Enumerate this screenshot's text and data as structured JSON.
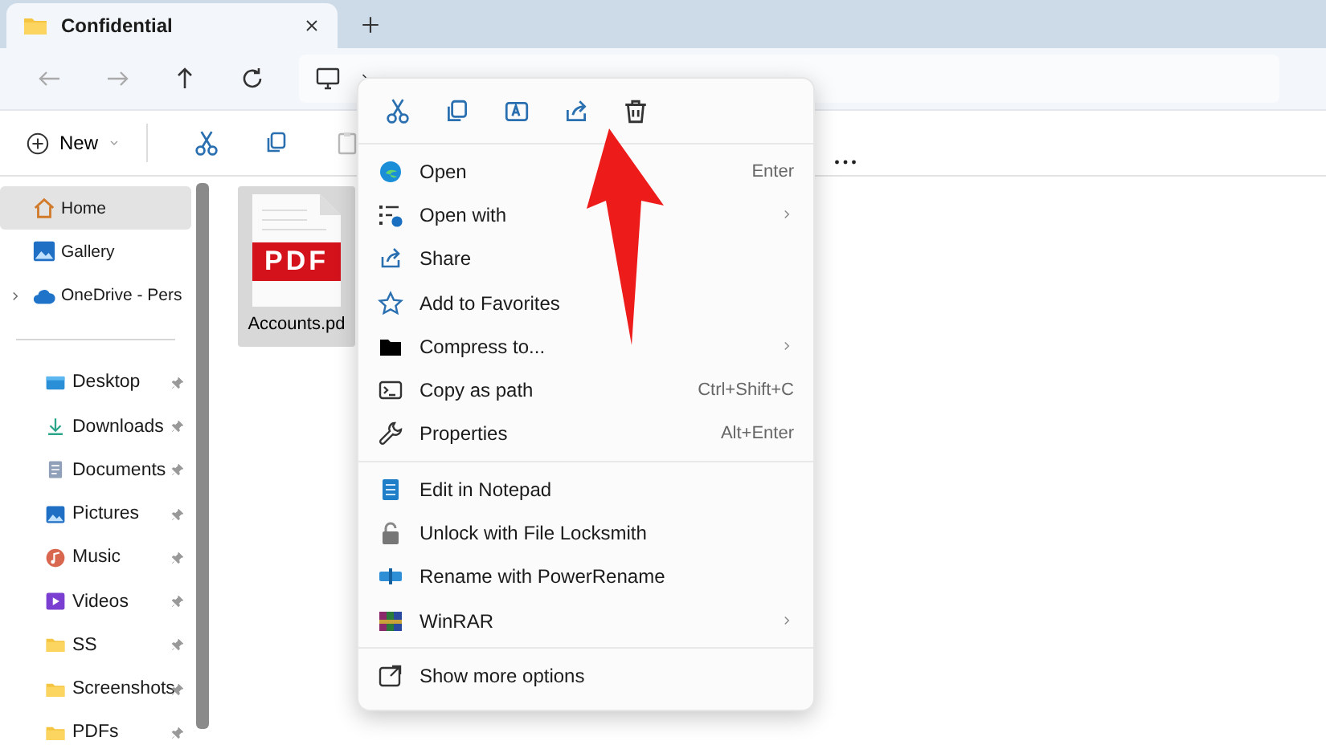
{
  "tab": {
    "title": "Confidential",
    "selected": true
  },
  "toolbar": {
    "new_label": "New"
  },
  "sidebar": {
    "top_items": [
      {
        "label": "Home",
        "selected": true,
        "expandable": false
      },
      {
        "label": "Gallery",
        "selected": false,
        "expandable": false
      },
      {
        "label": "OneDrive - Pers",
        "selected": false,
        "expandable": true
      }
    ],
    "pinned_items": [
      {
        "label": "Desktop",
        "selected": false
      },
      {
        "label": "Downloads",
        "selected": false
      },
      {
        "label": "Documents",
        "selected": false
      },
      {
        "label": "Pictures",
        "selected": false
      },
      {
        "label": "Music",
        "selected": false
      },
      {
        "label": "Videos",
        "selected": false
      },
      {
        "label": "SS",
        "selected": false
      },
      {
        "label": "Screenshots",
        "selected": false
      },
      {
        "label": "PDFs",
        "selected": false
      }
    ]
  },
  "files": [
    {
      "name": "Accounts.pd",
      "badge": "PDF",
      "selected": true
    }
  ],
  "context_menu": {
    "groups": [
      [
        {
          "label": "Open",
          "shortcut": "Enter",
          "submenu": false
        },
        {
          "label": "Open with",
          "submenu": true
        },
        {
          "label": "Share",
          "submenu": false
        },
        {
          "label": "Add to Favorites",
          "submenu": false
        },
        {
          "label": "Compress to...",
          "submenu": true
        },
        {
          "label": "Copy as path",
          "shortcut": "Ctrl+Shift+C",
          "submenu": false
        },
        {
          "label": "Properties",
          "shortcut": "Alt+Enter",
          "submenu": false
        }
      ],
      [
        {
          "label": "Edit in Notepad",
          "submenu": false
        },
        {
          "label": "Unlock with File Locksmith",
          "submenu": false
        },
        {
          "label": "Rename with PowerRename",
          "submenu": false
        },
        {
          "label": "WinRAR",
          "submenu": true
        }
      ],
      [
        {
          "label": "Show more options",
          "submenu": false
        }
      ]
    ]
  }
}
